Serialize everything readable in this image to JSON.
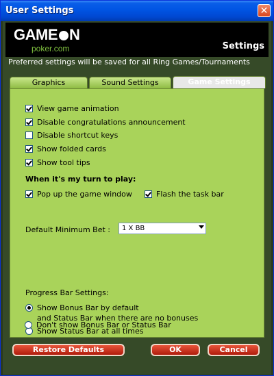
{
  "window": {
    "title": "User Settings",
    "close_icon": "close-icon"
  },
  "header": {
    "logo_main": "GAME",
    "logo_main2": "N",
    "logo_sub": "poker.com",
    "section": "Settings"
  },
  "info_text": "Preferred settings will be saved for all Ring Games/Tournaments",
  "tabs": [
    {
      "label": "Graphics",
      "active": false
    },
    {
      "label": "Sound Settings",
      "active": false
    },
    {
      "label": "Game Settings",
      "active": true
    }
  ],
  "options": [
    {
      "label": "View game animation",
      "checked": true
    },
    {
      "label": "Disable congratulations announcement",
      "checked": true
    },
    {
      "label": "Disable shortcut keys",
      "checked": false
    },
    {
      "label": "Show folded cards",
      "checked": true
    },
    {
      "label": "Show tool tips",
      "checked": true
    }
  ],
  "turn_heading": "When it's my turn to play:",
  "turn_options": [
    {
      "label": "Pop up the game window",
      "checked": true
    },
    {
      "label": "Flash the task bar",
      "checked": true
    }
  ],
  "min_bet": {
    "label": "Default Minimum Bet :",
    "value": "1 X BB"
  },
  "progress": {
    "heading": "Progress Bar Settings:",
    "options": [
      {
        "label": "Show Bonus Bar by default",
        "label2": "and Status Bar when there are no bonuses",
        "selected": true
      },
      {
        "label": "Show Status Bar at all times",
        "selected": false
      },
      {
        "label": "Don't show Bonus Bar or Status Bar",
        "selected": false
      }
    ]
  },
  "buttons": {
    "restore": "Restore Defaults",
    "ok": "OK",
    "cancel": "Cancel"
  }
}
